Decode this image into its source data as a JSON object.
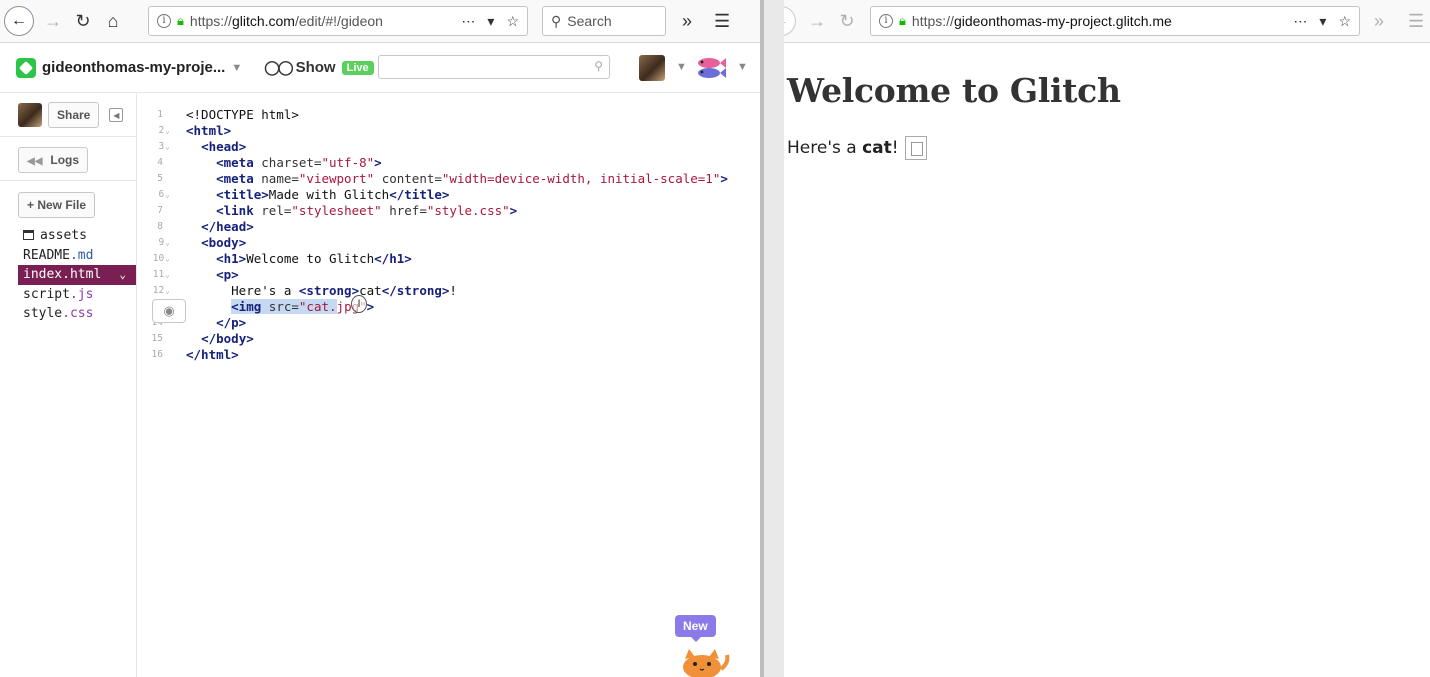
{
  "left_browser": {
    "url_prefix": "https://",
    "url_host": "glitch.com",
    "url_rest": "/edit/#!/gideon",
    "search_placeholder": "Search"
  },
  "right_browser": {
    "url_prefix": "https://",
    "url_host": "gideonthomas-my-project.glitch.me",
    "url_rest": ""
  },
  "glitch_header": {
    "project_name": "gideonthomas-my-proje...",
    "show_label": "Show",
    "live_badge": "Live",
    "search_value": ""
  },
  "sidebar": {
    "share_label": "Share",
    "logs_label": "Logs",
    "new_file_label": "+ New File",
    "files": [
      {
        "name": "assets",
        "ext": ""
      },
      {
        "name": "README",
        "ext": ".md"
      },
      {
        "name": "index",
        "ext": ".html"
      },
      {
        "name": "script",
        "ext": ".js"
      },
      {
        "name": "style",
        "ext": ".css"
      }
    ]
  },
  "editor": {
    "line_numbers": [
      "1",
      "2",
      "3",
      "4",
      "5",
      "6",
      "7",
      "8",
      "9",
      "10",
      "11",
      "12",
      "13",
      "14",
      "15",
      "16"
    ],
    "lines": [
      [
        {
          "t": "<!DOCTYPE html>",
          "c": "plain"
        }
      ],
      [
        {
          "t": "<html>",
          "c": "tag"
        }
      ],
      [
        {
          "t": "  ",
          "c": "plain"
        },
        {
          "t": "<head>",
          "c": "tag"
        }
      ],
      [
        {
          "t": "    ",
          "c": "plain"
        },
        {
          "t": "<meta",
          "c": "tag"
        },
        {
          "t": " charset=",
          "c": "attr"
        },
        {
          "t": "\"utf-8\"",
          "c": "str"
        },
        {
          "t": ">",
          "c": "tag"
        }
      ],
      [
        {
          "t": "    ",
          "c": "plain"
        },
        {
          "t": "<meta",
          "c": "tag"
        },
        {
          "t": " name=",
          "c": "attr"
        },
        {
          "t": "\"viewport\"",
          "c": "str"
        },
        {
          "t": " content=",
          "c": "attr"
        },
        {
          "t": "\"width=device-width, initial-scale=1\"",
          "c": "str"
        },
        {
          "t": ">",
          "c": "tag"
        }
      ],
      [
        {
          "t": "    ",
          "c": "plain"
        },
        {
          "t": "<title>",
          "c": "tag"
        },
        {
          "t": "Made with Glitch",
          "c": "plain"
        },
        {
          "t": "</title>",
          "c": "tag"
        }
      ],
      [
        {
          "t": "    ",
          "c": "plain"
        },
        {
          "t": "<link",
          "c": "tag"
        },
        {
          "t": " rel=",
          "c": "attr"
        },
        {
          "t": "\"stylesheet\"",
          "c": "str"
        },
        {
          "t": " href=",
          "c": "attr"
        },
        {
          "t": "\"style.css\"",
          "c": "str"
        },
        {
          "t": ">",
          "c": "tag"
        }
      ],
      [
        {
          "t": "  ",
          "c": "plain"
        },
        {
          "t": "</head>",
          "c": "tag"
        }
      ],
      [
        {
          "t": "  ",
          "c": "plain"
        },
        {
          "t": "<body>",
          "c": "tag"
        }
      ],
      [
        {
          "t": "    ",
          "c": "plain"
        },
        {
          "t": "<h1>",
          "c": "tag"
        },
        {
          "t": "Welcome to Glitch",
          "c": "plain"
        },
        {
          "t": "</h1>",
          "c": "tag"
        }
      ],
      [
        {
          "t": "    ",
          "c": "plain"
        },
        {
          "t": "<p>",
          "c": "tag"
        }
      ],
      [
        {
          "t": "      Here's a ",
          "c": "plain"
        },
        {
          "t": "<strong>",
          "c": "tag"
        },
        {
          "t": "cat",
          "c": "plain"
        },
        {
          "t": "</strong>",
          "c": "tag"
        },
        {
          "t": "!",
          "c": "plain"
        }
      ],
      [
        {
          "t": "      ",
          "c": "plain"
        },
        {
          "t": "<img",
          "c": "tag hl"
        },
        {
          "t": " src=",
          "c": "attr hl"
        },
        {
          "t": "\"cat.",
          "c": "str hl"
        },
        {
          "t": "jpg\"",
          "c": "str"
        },
        {
          "t": ">",
          "c": "tag"
        }
      ],
      [
        {
          "t": "    ",
          "c": "plain"
        },
        {
          "t": "</p>",
          "c": "tag"
        }
      ],
      [
        {
          "t": "  ",
          "c": "plain"
        },
        {
          "t": "</body>",
          "c": "tag"
        }
      ],
      [
        {
          "t": "</html>",
          "c": "tag"
        }
      ]
    ],
    "new_badge": "New"
  },
  "preview": {
    "heading": "Welcome to Glitch",
    "text_before": "Here's a ",
    "text_strong": "cat",
    "text_after": "!"
  }
}
